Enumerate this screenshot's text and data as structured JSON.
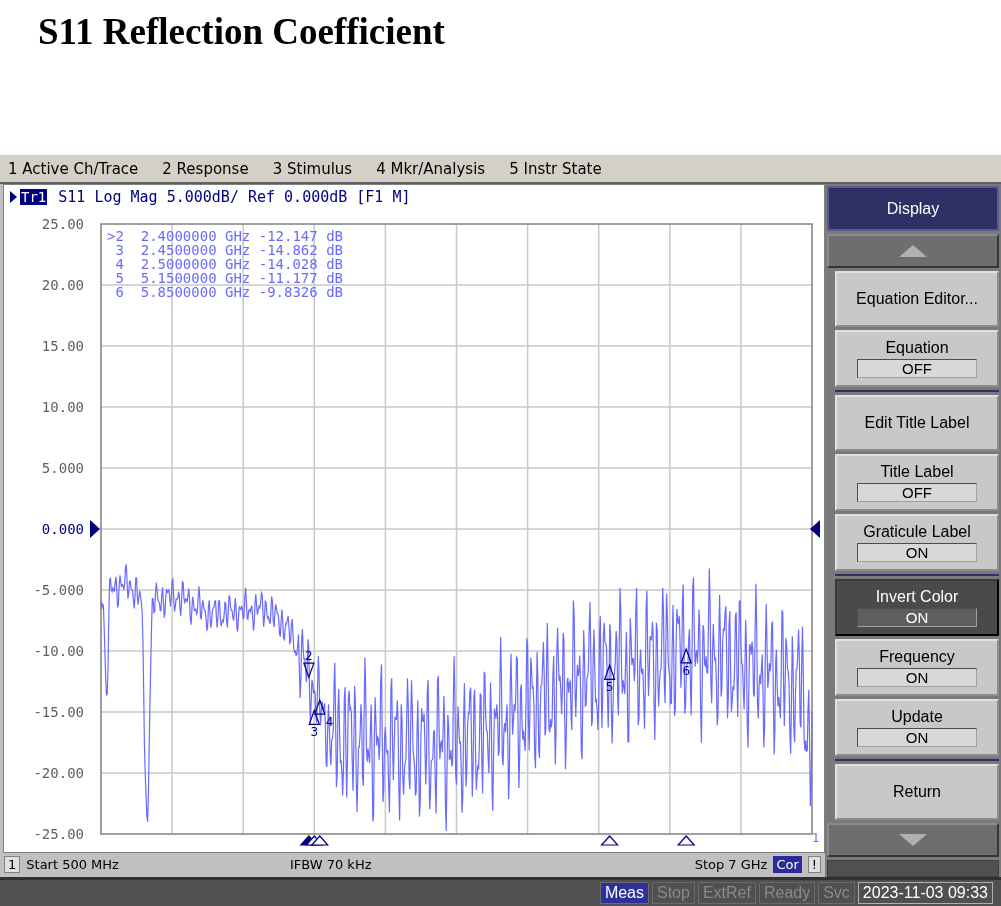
{
  "title": "S11 Reflection Coefficient",
  "menu": [
    {
      "label": "1 Active Ch/Trace"
    },
    {
      "label": "2 Response"
    },
    {
      "label": "3 Stimulus"
    },
    {
      "label": "4 Mkr/Analysis"
    },
    {
      "label": "5 Instr State"
    }
  ],
  "trace_header": {
    "trace": "Tr1",
    "text": "S11 Log Mag 5.000dB/ Ref 0.000dB [F1 M]"
  },
  "y_axis_labels": [
    {
      "label": "25.00",
      "reference": false
    },
    {
      "label": "20.00",
      "reference": false
    },
    {
      "label": "15.00",
      "reference": false
    },
    {
      "label": "10.00",
      "reference": false
    },
    {
      "label": "5.000",
      "reference": false
    },
    {
      "label": "0.000",
      "reference": true
    },
    {
      "label": "-5.000",
      "reference": false
    },
    {
      "label": "-10.00",
      "reference": false
    },
    {
      "label": "-15.00",
      "reference": false
    },
    {
      "label": "-20.00",
      "reference": false
    },
    {
      "label": "-25.00",
      "reference": false
    }
  ],
  "markers": [
    {
      "readout_id": ">2",
      "frequency": "2.4000000 GHz",
      "value": "-12.147 dB",
      "trace_label": "2",
      "selected": true
    },
    {
      "readout_id": "3",
      "frequency": "2.4500000 GHz",
      "value": "-14.862 dB",
      "trace_label": "3",
      "selected": false
    },
    {
      "readout_id": "4",
      "frequency": "2.5000000 GHz",
      "value": "-14.028 dB",
      "trace_label": "4",
      "selected": false
    },
    {
      "readout_id": "5",
      "frequency": "5.1500000 GHz",
      "value": "-11.177 dB",
      "trace_label": "5",
      "selected": false
    },
    {
      "readout_id": "6",
      "frequency": "5.8500000 GHz",
      "value": "-9.8326 dB",
      "trace_label": "6",
      "selected": false
    }
  ],
  "trace_end_label": "1",
  "status": {
    "channel": "1",
    "start": "Start 500 MHz",
    "ifbw": "IFBW 70 kHz",
    "stop": "Stop 7 GHz",
    "correction": "Cor",
    "warning": "!"
  },
  "softkeys": [
    {
      "kind": "header",
      "label": "Display"
    },
    {
      "kind": "scroll_up"
    },
    {
      "kind": "action",
      "label": "Equation Editor..."
    },
    {
      "kind": "toggle",
      "label": "Equation",
      "value": "OFF",
      "selected": false
    },
    {
      "kind": "divider"
    },
    {
      "kind": "action",
      "label": "Edit Title Label"
    },
    {
      "kind": "toggle",
      "label": "Title Label",
      "value": "OFF",
      "selected": false
    },
    {
      "kind": "toggle",
      "label": "Graticule Label",
      "value": "ON",
      "selected": false
    },
    {
      "kind": "divider"
    },
    {
      "kind": "toggle",
      "label": "Invert Color",
      "value": "ON",
      "selected": true
    },
    {
      "kind": "toggle",
      "label": "Frequency",
      "value": "ON",
      "selected": false
    },
    {
      "kind": "toggle",
      "label": "Update",
      "value": "ON",
      "selected": false
    },
    {
      "kind": "divider"
    },
    {
      "kind": "action",
      "label": "Return"
    },
    {
      "kind": "scroll_down"
    }
  ],
  "indicators": [
    {
      "label": "Meas",
      "on": true
    },
    {
      "label": "Stop",
      "on": false
    },
    {
      "label": "ExtRef",
      "on": false
    },
    {
      "label": "Ready",
      "on": false
    },
    {
      "label": "Svc",
      "on": false
    }
  ],
  "datetime": "2023-11-03 09:33"
}
